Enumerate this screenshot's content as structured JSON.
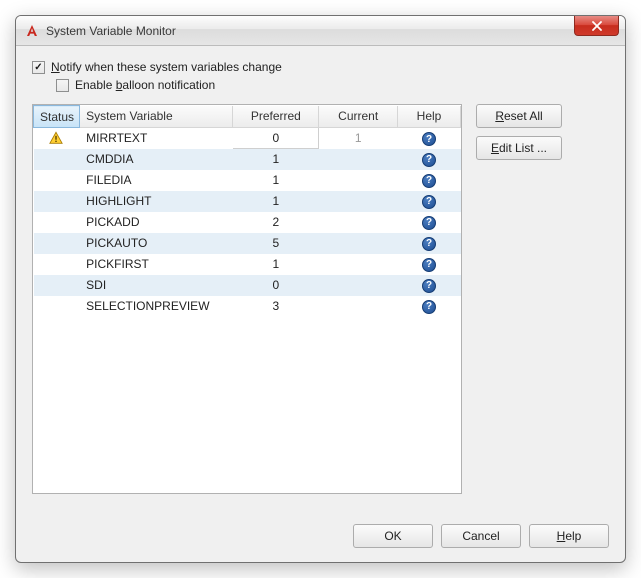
{
  "window": {
    "title": "System Variable Monitor"
  },
  "options": {
    "notify_label_pre": "N",
    "notify_label_rest": "otify when these system variables change",
    "notify_checked": true,
    "balloon_label_pre": "Enable ",
    "balloon_label_u": "b",
    "balloon_label_rest": "alloon notification",
    "balloon_checked": false
  },
  "table": {
    "headers": {
      "status": "Status",
      "sysvar": "System Variable",
      "preferred": "Preferred",
      "current": "Current",
      "help": "Help"
    },
    "rows": [
      {
        "status": "warn",
        "name": "MIRRTEXT",
        "preferred": "0",
        "current": "1",
        "editPreferred": true
      },
      {
        "status": "",
        "name": "CMDDIA",
        "preferred": "1",
        "current": ""
      },
      {
        "status": "",
        "name": "FILEDIA",
        "preferred": "1",
        "current": ""
      },
      {
        "status": "",
        "name": "HIGHLIGHT",
        "preferred": "1",
        "current": ""
      },
      {
        "status": "",
        "name": "PICKADD",
        "preferred": "2",
        "current": ""
      },
      {
        "status": "",
        "name": "PICKAUTO",
        "preferred": "5",
        "current": ""
      },
      {
        "status": "",
        "name": "PICKFIRST",
        "preferred": "1",
        "current": ""
      },
      {
        "status": "",
        "name": "SDI",
        "preferred": "0",
        "current": ""
      },
      {
        "status": "",
        "name": "SELECTIONPREVIEW",
        "preferred": "3",
        "current": ""
      }
    ]
  },
  "buttons": {
    "reset_all_pre": "R",
    "reset_all_rest": "eset All",
    "edit_list_pre": "E",
    "edit_list_rest": "dit List ...",
    "ok": "OK",
    "cancel": "Cancel",
    "help_pre": "H",
    "help_rest": "elp"
  }
}
